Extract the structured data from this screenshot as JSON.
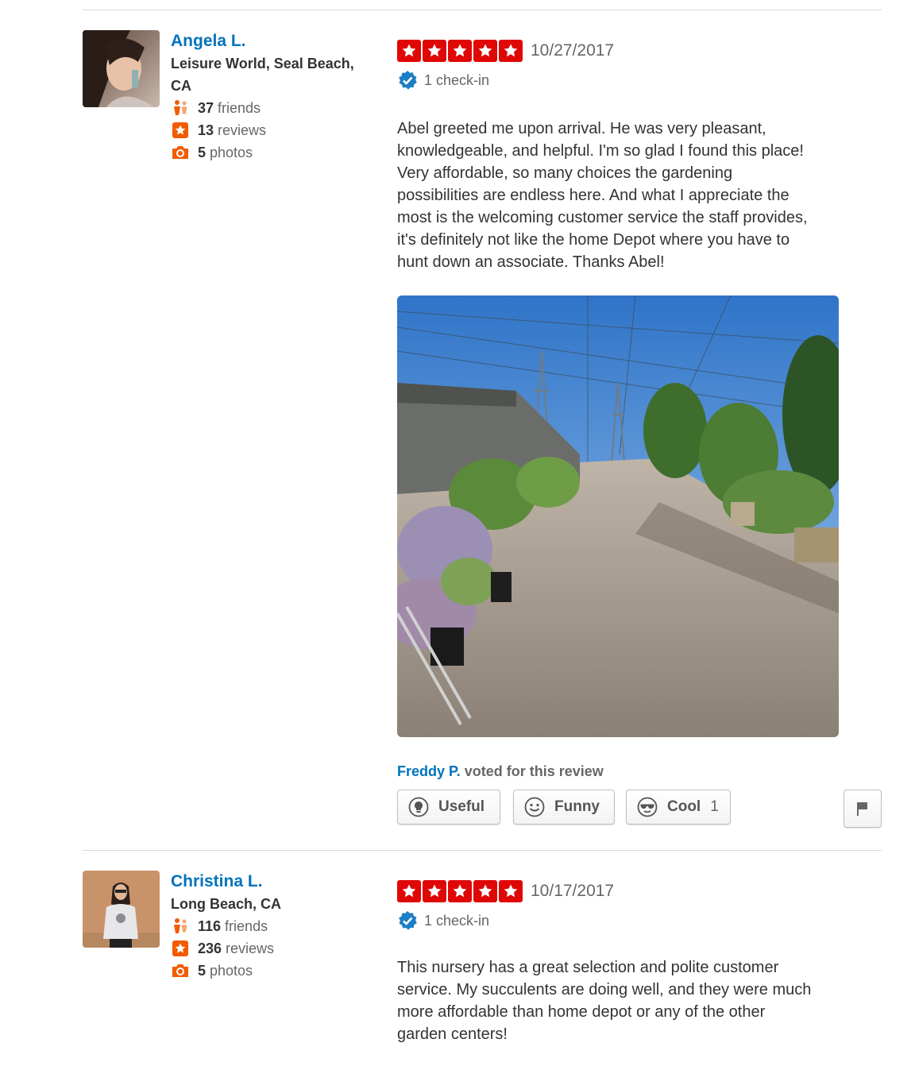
{
  "reviews": [
    {
      "user": {
        "name": "Angela L.",
        "location": "Leisure World, Seal Beach, CA",
        "friends_count": "37",
        "friends_label": "friends",
        "reviews_count": "13",
        "reviews_label": "reviews",
        "photos_count": "5",
        "photos_label": "photos"
      },
      "rating_stars": 5,
      "date": "10/27/2017",
      "checkin": "1 check-in",
      "text": "Abel greeted me upon arrival. He was very pleasant,\nknowledgeable, and helpful. I'm so glad I found this place!\nVery affordable, so many choices the gardening\npossibilities are endless here. And what I appreciate the\nmost is the welcoming customer service the staff provides,\nit's definitely not like the home Depot where you have to\nhunt down an associate. Thanks Abel!",
      "voter": "Freddy P.",
      "voted_text": " voted for this review",
      "buttons": {
        "useful": "Useful",
        "funny": "Funny",
        "cool": "Cool",
        "cool_count": "1"
      }
    },
    {
      "user": {
        "name": "Christina L.",
        "location": "Long Beach, CA",
        "friends_count": "116",
        "friends_label": "friends",
        "reviews_count": "236",
        "reviews_label": "reviews",
        "photos_count": "5",
        "photos_label": "photos"
      },
      "rating_stars": 5,
      "date": "10/17/2017",
      "checkin": "1 check-in",
      "text": "This nursery has a great selection and polite customer\nservice. My succulents are doing well, and they were much\nmore affordable than home depot or any of the other\ngarden centers!"
    }
  ],
  "colors": {
    "star_red": "#e00707",
    "link_blue": "#0073bb",
    "stat_orange": "#f15c00"
  },
  "icons": [
    "friends-icon",
    "review-star-icon",
    "camera-icon",
    "verified-checkin-icon",
    "lightbulb-icon",
    "smile-icon",
    "sunglasses-icon",
    "flag-icon"
  ]
}
